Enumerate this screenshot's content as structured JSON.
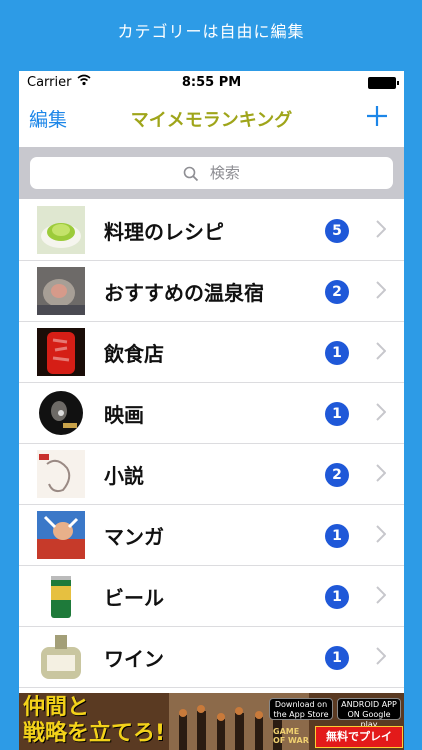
{
  "caption": "カテゴリーは自由に編集",
  "status": {
    "carrier": "Carrier",
    "time": "8:55 PM"
  },
  "nav": {
    "edit": "編集",
    "title": "マイメモランキング",
    "add": "+"
  },
  "search": {
    "placeholder": "検索"
  },
  "items": [
    {
      "label": "料理のレシピ",
      "count": "5",
      "thumb": "food-photo"
    },
    {
      "label": "おすすめの温泉宿",
      "count": "2",
      "thumb": "monkey-photo"
    },
    {
      "label": "飲食店",
      "count": "1",
      "thumb": "lantern-photo"
    },
    {
      "label": "映画",
      "count": "1",
      "thumb": "film-disc-photo"
    },
    {
      "label": "小説",
      "count": "2",
      "thumb": "book-cover-photo"
    },
    {
      "label": "マンガ",
      "count": "1",
      "thumb": "manga-photo"
    },
    {
      "label": "ビール",
      "count": "1",
      "thumb": "beer-can-photo"
    },
    {
      "label": "ワイン",
      "count": "1",
      "thumb": "wine-bottle-photo"
    }
  ],
  "ad": {
    "headline_1": "仲間と",
    "headline_2": "戦略を立てろ!",
    "store_1": "Download on the App Store",
    "store_2": "ANDROID APP ON Google play",
    "cta": "無料でプレイ",
    "brand": "GAME OF WAR"
  },
  "colors": {
    "background": "#2d9be6",
    "accent": "#1c86e8",
    "title": "#9fa51a",
    "badge": "#1f58d8"
  }
}
